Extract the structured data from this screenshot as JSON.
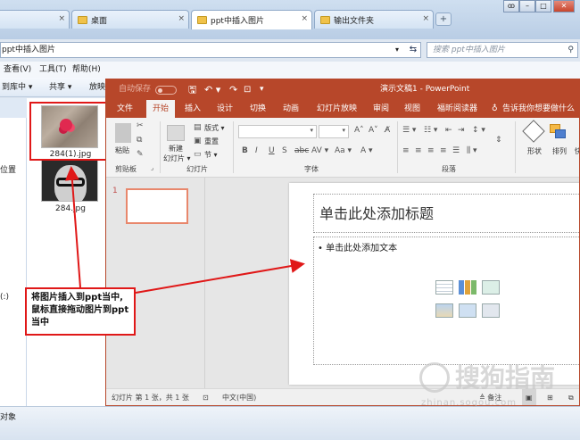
{
  "explorer": {
    "tabs": [
      {
        "label": "桌面",
        "close": "×"
      },
      {
        "label": "ppt中插入图片",
        "close": "×"
      },
      {
        "label": "输出文件夹",
        "close": "×"
      }
    ],
    "new_tab": "+",
    "window_controls": {
      "user": "ꝏ",
      "minimize": "–",
      "maximize": "□",
      "close": "✕"
    },
    "address": "ppt中插入图片",
    "search_placeholder": "搜索 ppt中插入图片",
    "menu": [
      "查看(V)",
      "工具(T)",
      "帮助(H)"
    ],
    "commands": [
      "到库中 ▾",
      "共享 ▾",
      "放映"
    ],
    "nav_partial": [
      "位置",
      "(:)"
    ],
    "files": [
      "284(1).jpg",
      "284.jpg"
    ],
    "status_partial": "对象"
  },
  "powerpoint": {
    "autosave_label": "自动保存",
    "doc_title": "演示文稿1  -  PowerPoint",
    "tabs": [
      "文件",
      "开始",
      "插入",
      "设计",
      "切换",
      "动画",
      "幻灯片放映",
      "审阅",
      "视图",
      "福昕阅读器"
    ],
    "tell_me": "告诉我你想要做什么",
    "ribbon": {
      "paste": "粘贴",
      "clipboard_group": "剪贴板",
      "new_slide": "新建",
      "new_slide2": "幻灯片 ▾",
      "layout": "版式 ▾",
      "reset": "重置",
      "section": "节 ▾",
      "slides_group": "幻灯片",
      "font_group": "字体",
      "paragraph_group": "段落",
      "shapes": "形状",
      "arrange": "排列",
      "drawing_partial": "快"
    },
    "slide_number": "1",
    "title_placeholder": "单击此处添加标题",
    "body_placeholder": "• 单击此处添加文本",
    "status": {
      "slide_info": "幻灯片 第 1 张，共 1 张",
      "language": "中文(中国)",
      "notes": "≜ 备注"
    }
  },
  "annotation": {
    "text": "将图片插入到ppt当中,鼠标直接拖动图片到ppt当中"
  },
  "watermark": {
    "text": "搜狗指南",
    "url": "zhinan.sogou.com"
  }
}
